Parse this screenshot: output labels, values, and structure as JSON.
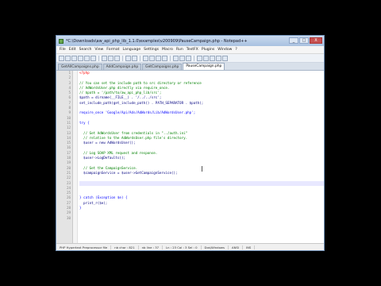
{
  "window": {
    "title": "*C:\\Downloads\\aw_api_php_lib_1.1.0\\examples\\v200909\\PauseCampaign.php - Notepad++",
    "controls": [
      "_",
      "□",
      "X"
    ]
  },
  "menu": [
    "File",
    "Edit",
    "Search",
    "View",
    "Format",
    "Language",
    "Settings",
    "Macro",
    "Run",
    "TextFX",
    "Plugins",
    "Window",
    "?"
  ],
  "tabs": [
    {
      "label": "GetAllCampaigns.php",
      "active": false
    },
    {
      "label": "AddCampaign.php",
      "active": false
    },
    {
      "label": "GetCampaigns.php",
      "active": false
    },
    {
      "label": "PauseCampaign.php",
      "active": true
    }
  ],
  "editor": {
    "colors": {
      "comment": "#008000",
      "keyword": "#0000ff",
      "string": "#808080",
      "variable": "#000080",
      "php_tag": "#ff0000",
      "default": "#000000"
    },
    "lines": [
      {
        "n": "1",
        "text": "<?php",
        "color": "php_tag"
      },
      {
        "n": "2",
        "text": "",
        "color": "default"
      },
      {
        "n": "3",
        "text": "// You can set the include path to src directory or reference",
        "color": "comment"
      },
      {
        "n": "4",
        "text": "// AdWordsUser.php directly via require_once.",
        "color": "comment"
      },
      {
        "n": "5",
        "text": "// $path = '/path/to/aw_api_php_lib/src';",
        "color": "comment"
      },
      {
        "n": "6",
        "text": "$path = dirname(__FILE__) . '/../../src';",
        "color": "variable"
      },
      {
        "n": "7",
        "text": "set_include_path(get_include_path() . PATH_SEPARATOR . $path);",
        "color": "variable"
      },
      {
        "n": "8",
        "text": "",
        "color": "default"
      },
      {
        "n": "9",
        "text": "require_once 'Google/Api/Ads/AdWords/Lib/AdWordsUser.php';",
        "color": "keyword"
      },
      {
        "n": "10",
        "text": "",
        "color": "default"
      },
      {
        "n": "11",
        "text": "try {",
        "color": "keyword"
      },
      {
        "n": "12",
        "text": "",
        "color": "default"
      },
      {
        "n": "13",
        "text": "  // Get AdWordsUser from credentials in \"../auth.ini\"",
        "color": "comment"
      },
      {
        "n": "14",
        "text": "  // relative to the AdWordsUser.php file's directory.",
        "color": "comment"
      },
      {
        "n": "15",
        "text": "  $user = new AdWordsUser();",
        "color": "variable"
      },
      {
        "n": "16",
        "text": "",
        "color": "default"
      },
      {
        "n": "17",
        "text": "  // Log SOAP XML request and response.",
        "color": "comment"
      },
      {
        "n": "18",
        "text": "  $user->LogDefaults();",
        "color": "variable"
      },
      {
        "n": "19",
        "text": "",
        "color": "default"
      },
      {
        "n": "20",
        "text": "  // Get the CampaignService.",
        "color": "comment"
      },
      {
        "n": "21",
        "text": "  $campaignService = $user->GetCampaignService();",
        "color": "variable"
      },
      {
        "n": "22",
        "text": "",
        "color": "default"
      },
      {
        "n": "23",
        "text": "",
        "color": "default"
      },
      {
        "n": "24",
        "text": "",
        "color": "default"
      },
      {
        "n": "25",
        "text": "",
        "color": "default"
      },
      {
        "n": "26",
        "text": "} catch (Exception $e) {",
        "color": "keyword"
      },
      {
        "n": "27",
        "text": "  print_r($e);",
        "color": "variable"
      },
      {
        "n": "28",
        "text": "}",
        "color": "keyword"
      },
      {
        "n": "29",
        "text": "",
        "color": "default"
      },
      {
        "n": "30",
        "text": "",
        "color": "default"
      }
    ],
    "current_line": "23"
  },
  "status": [
    "PHP Hypertext Preprocessor file",
    "nb char : 821",
    "nb line : 37",
    "Ln : 23   Col : 3   Sel : 0",
    "Dos\\Windows",
    "ANSI",
    "INS"
  ]
}
